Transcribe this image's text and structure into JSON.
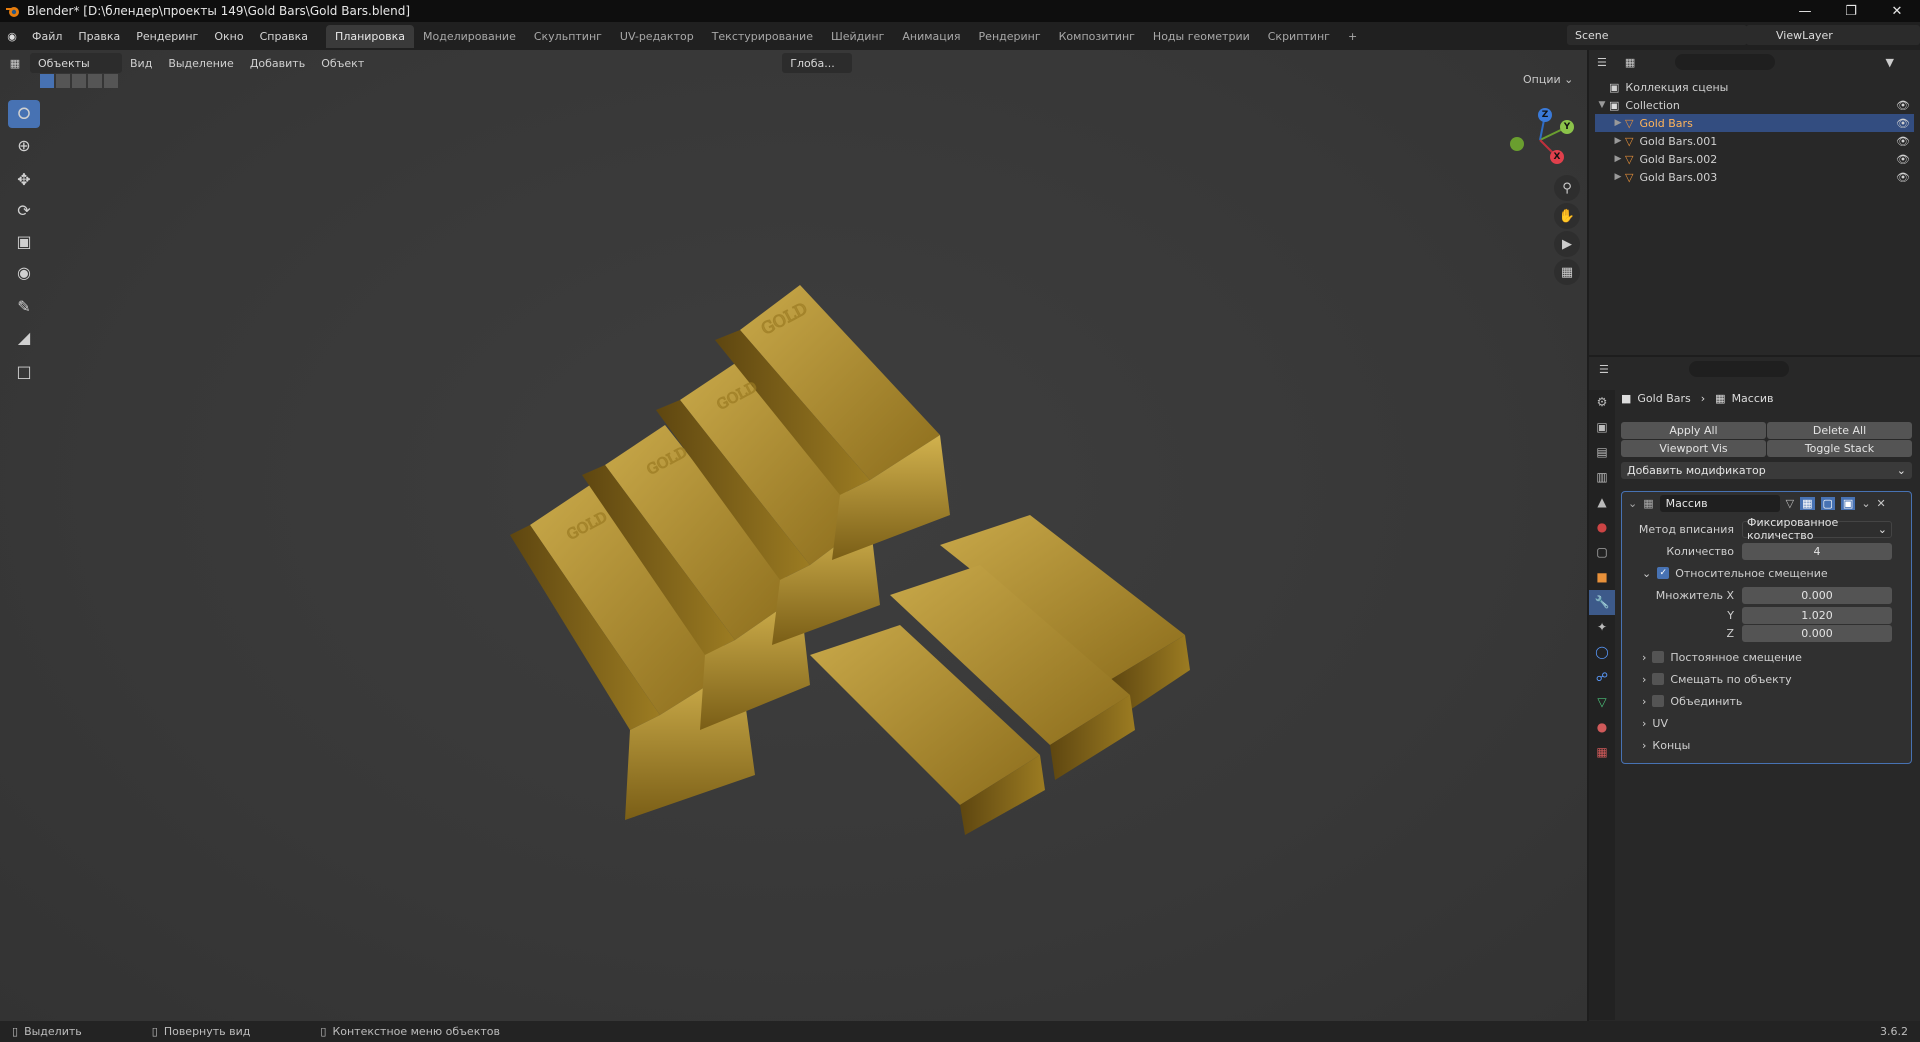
{
  "title_bar": {
    "text": "Blender* [D:\\блендер\\проекты 149\\Gold Bars\\Gold Bars.blend]"
  },
  "menu": [
    "Файл",
    "Правка",
    "Рендеринг",
    "Окно",
    "Справка"
  ],
  "workspaces": [
    "Планировка",
    "Моделирование",
    "Скульптинг",
    "UV-редактор",
    "Текстурирование",
    "Шейдинг",
    "Анимация",
    "Рендеринг",
    "Композитинг",
    "Ноды геометрии",
    "Скриптинг"
  ],
  "active_workspace_index": 0,
  "scene": {
    "name": "Scene"
  },
  "view_layer": {
    "name": "ViewLayer"
  },
  "viewport_header": {
    "mode": "Объекты",
    "menus": [
      "Вид",
      "Выделение",
      "Добавить",
      "Объект"
    ],
    "orientation": "Глоба...",
    "options": "Опции"
  },
  "gizmo": {
    "x": "X",
    "y": "Y",
    "z": "Z"
  },
  "outliner": {
    "root": "Коллекция сцены",
    "collection": "Collection",
    "items": [
      {
        "name": "Gold Bars",
        "selected": true
      },
      {
        "name": "Gold Bars.001",
        "selected": false
      },
      {
        "name": "Gold Bars.002",
        "selected": false
      },
      {
        "name": "Gold Bars.003",
        "selected": false
      }
    ]
  },
  "properties": {
    "breadcrumb_object": "Gold Bars",
    "breadcrumb_modifier": "Массив",
    "apply_all": "Apply All",
    "delete_all": "Delete All",
    "viewport_vis": "Viewport Vis",
    "toggle_stack": "Toggle Stack",
    "add_modifier": "Добавить модификатор",
    "modifier": {
      "name": "Массив",
      "fit_type_label": "Метод вписания",
      "fit_type_value": "Фиксированное количество",
      "count_label": "Количество",
      "count_value": "4",
      "relative_offset_label": "Относительное смещение",
      "relative_offset_enabled": true,
      "factor_x_label": "Множитель X",
      "factor_x": "0.000",
      "factor_y_label": "Y",
      "factor_y": "1.020",
      "factor_z_label": "Z",
      "factor_z": "0.000",
      "constant_offset": "Постоянное смещение",
      "object_offset": "Смещать по объекту",
      "merge": "Объединить",
      "uv": "UV",
      "caps": "Концы"
    }
  },
  "status_bar": {
    "select": "Выделить",
    "rotate": "Повернуть вид",
    "context": "Контекстное меню объектов",
    "version": "3.6.2"
  },
  "colors": {
    "accent": "#4772b3",
    "gold": "#b8962e",
    "panel": "#282828"
  }
}
